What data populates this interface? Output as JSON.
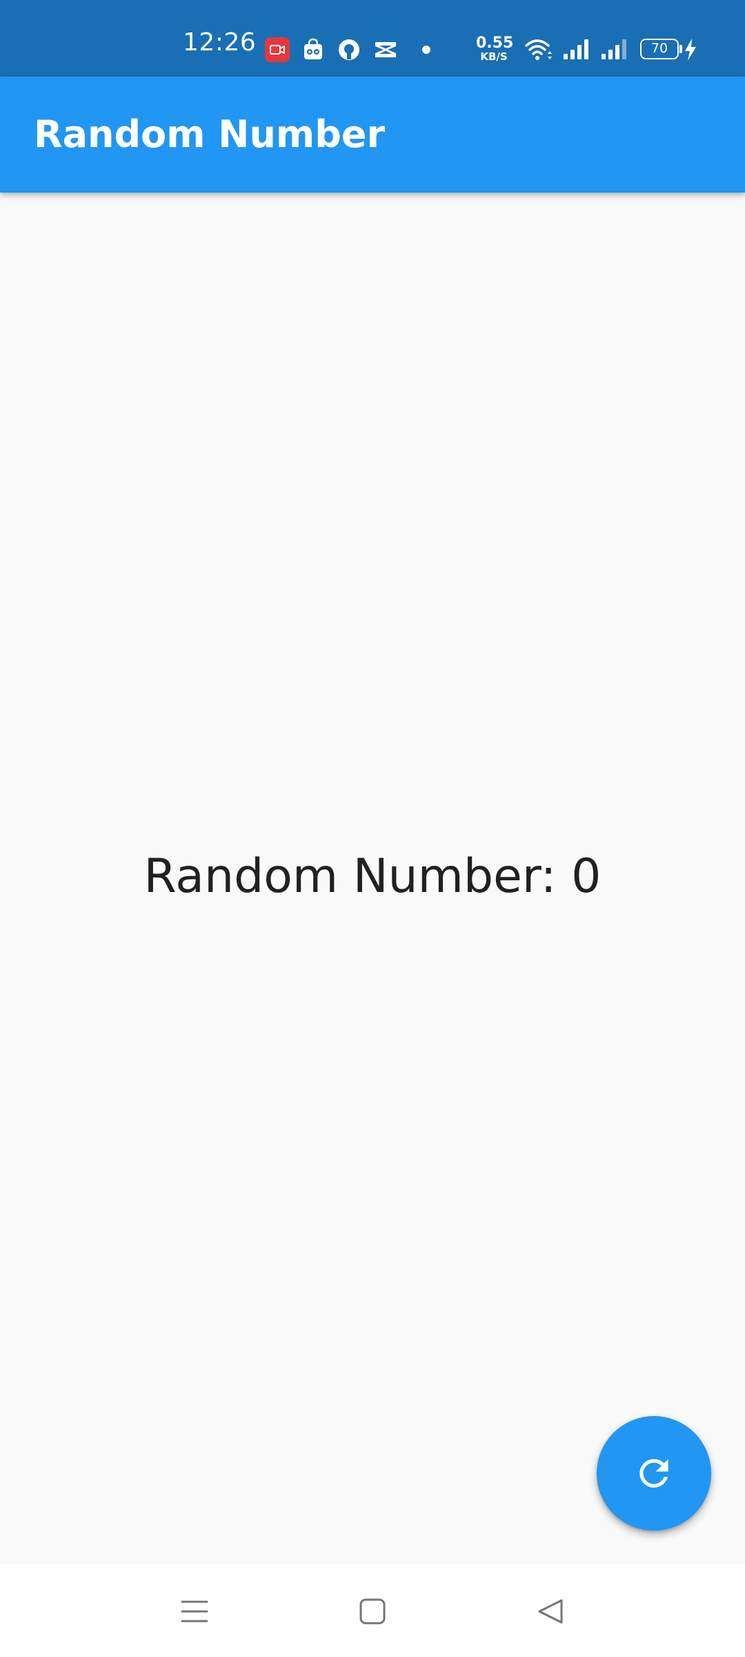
{
  "status_bar": {
    "time": "12:26",
    "net_speed_value": "0.55",
    "net_speed_unit": "KB/S",
    "battery_level": "70",
    "icons": [
      "screen-record-icon",
      "shopping-bag-icon",
      "circle-app-icon",
      "capcut-icon",
      "notification-dot-icon",
      "wifi-icon",
      "cell-signal-icon",
      "cell-signal-icon",
      "battery-icon",
      "charging-bolt-icon"
    ]
  },
  "app_bar": {
    "title": "Random Number"
  },
  "main": {
    "random_label": "Random Number: 0"
  },
  "fab": {
    "icon": "refresh-icon"
  },
  "nav_bar": {
    "icons": [
      "menu-icon",
      "home-square-icon",
      "back-triangle-icon"
    ]
  },
  "colors": {
    "status_bar_bg": "#1A6EB3",
    "primary": "#2196F3",
    "background": "#FAFAFA",
    "text": "#212121",
    "nav_bar_bg": "#FFFFFF",
    "nav_icon": "#757575"
  }
}
